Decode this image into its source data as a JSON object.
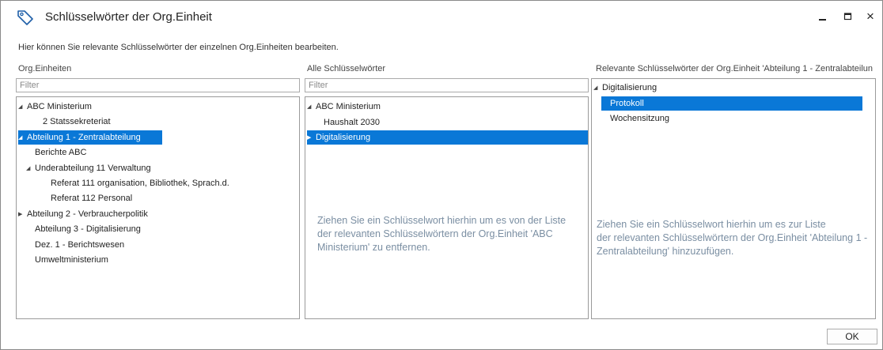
{
  "window": {
    "title": "Schlüsselwörter der Org.Einheit",
    "icon": "tag-icon",
    "controls": [
      "minimize-icon",
      "maximize-icon",
      "close-icon"
    ],
    "close_glyph": "×"
  },
  "description": "Hier können Sie relevante Schlüsselwörter der einzelnen Org.Einheiten bearbeiten.",
  "org_units": {
    "header": "Org.Einheiten",
    "filter_placeholder": "Filter",
    "tree": [
      {
        "label": "ABC Ministerium",
        "arrow": "expanded",
        "selected": false
      },
      {
        "label": "2 Statssekreteriat",
        "arrow": "",
        "selected": false
      },
      {
        "label": "Abteilung 1 - Zentralabteilung",
        "arrow": "expanded",
        "selected": true
      },
      {
        "label": "Berichte ABC",
        "arrow": "",
        "selected": false
      },
      {
        "label": "Underabteilung 11 Verwaltung",
        "arrow": "expanded",
        "selected": false
      },
      {
        "label": "Referat 111 organisation, Bibliothek, Sprach.d.",
        "arrow": "",
        "selected": false
      },
      {
        "label": "Referat 112 Personal",
        "arrow": "",
        "selected": false
      },
      {
        "label": "Abteilung 2 - Verbraucherpolitik",
        "arrow": "collapsed",
        "selected": false
      },
      {
        "label": "Abteilung 3 - Digitalisierung",
        "arrow": "",
        "selected": false
      },
      {
        "label": "Dez. 1 - Berichtswesen",
        "arrow": "",
        "selected": false
      },
      {
        "label": "Umweltministerium",
        "arrow": "",
        "selected": false
      }
    ]
  },
  "all_keywords": {
    "header": "Alle Schlüsselwörter",
    "filter_placeholder": "Filter",
    "tree": [
      {
        "label": "ABC Ministerium",
        "arrow": "expanded",
        "selected": false
      },
      {
        "label": "Haushalt 2030",
        "arrow": "",
        "selected": false
      },
      {
        "label": "Digitalisierung",
        "arrow": "collapsed",
        "selected": true
      }
    ],
    "drop_hint": [
      "Ziehen Sie ein Schlüsselwort hierhin um es von der Liste",
      "der relevanten Schlüsselwörtern der Org.Einheit 'ABC",
      "Ministerium' zu entfernen."
    ]
  },
  "relevant_keywords": {
    "header": "Relevante Schlüsselwörter der Org.Einheit 'Abteilung 1 - Zentralabteilun",
    "tree": [
      {
        "label": "Digitalisierung",
        "arrow": "expanded",
        "selected": false
      },
      {
        "label": "Protokoll",
        "arrow": "",
        "selected": true
      },
      {
        "label": "Wochensitzung",
        "arrow": "",
        "selected": false
      }
    ],
    "drop_hint": [
      "Ziehen Sie ein Schlüsselwort hierhin um es zur Liste",
      "der relevanten Schlüsselwörtern der Org.Einheit 'Abteilung 1 -",
      "Zentralabteilung' hinzuzufügen."
    ]
  },
  "ok_label": "OK",
  "colors": {
    "selection": "#0a78d7",
    "hint_text": "#7a8ea2"
  }
}
